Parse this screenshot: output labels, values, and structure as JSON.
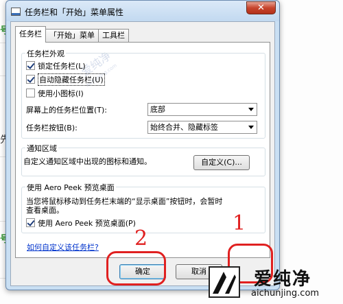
{
  "window": {
    "title": "任务栏和「开始」菜单属性",
    "close_glyph": "✕"
  },
  "tabs": [
    {
      "label": "任务栏",
      "active": true
    },
    {
      "label": "「开始」菜单",
      "active": false
    },
    {
      "label": "工具栏",
      "active": false
    }
  ],
  "appearance": {
    "group_label": "任务栏外观",
    "lock_taskbar": {
      "label": "锁定任务栏(L)",
      "checked": true
    },
    "auto_hide": {
      "label": "自动隐藏任务栏(U)",
      "checked": true
    },
    "small_icons": {
      "label": "使用小图标(I)",
      "checked": false
    },
    "position_label": "屏幕上的任务栏位置(T):",
    "position_value": "底部",
    "buttons_label": "任务栏按钮(B):",
    "buttons_value": "始终合并、隐藏标签"
  },
  "notification": {
    "group_label": "通知区域",
    "description": "自定义通知区域中出现的图标和通知。",
    "customize_button": "自定义(C)..."
  },
  "aero_peek": {
    "group_label": "使用 Aero Peek 预览桌面",
    "description_line1": "当您将鼠标移动到任务栏末端的“显示桌面”按钮时，会暂时",
    "description_line2": "查看桌面。",
    "checkbox": {
      "label": "使用 Aero Peek 预览桌面(P)",
      "checked": true
    }
  },
  "help_link": "如何自定义该任务栏?",
  "buttons": {
    "ok": "确定",
    "cancel": "取消"
  },
  "annotations": {
    "one": "1",
    "two": "2"
  },
  "background": {
    "glyph_a": "号",
    "glyph_b": "先",
    "glyph_c": "号"
  },
  "watermark": {
    "text": "爱纯净",
    "url": "aichunjing.com"
  },
  "logo": {
    "name": "爱纯净",
    "url": "aichunjing.com"
  },
  "colors": {
    "annotation_red": "#e02020",
    "link_blue": "#0033cc",
    "window_frame": "#c9dff3"
  }
}
